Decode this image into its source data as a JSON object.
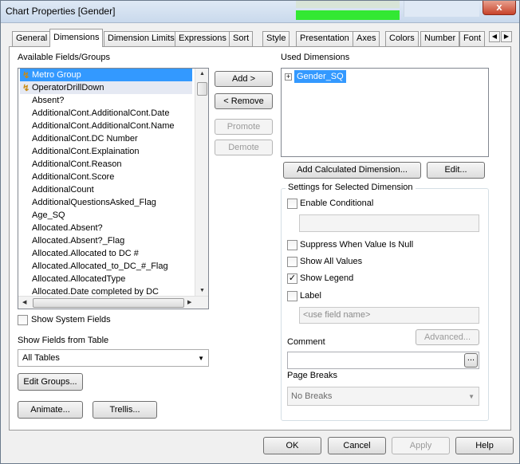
{
  "window": {
    "title": "Chart Properties [Gender]",
    "close_label": "x"
  },
  "tabs": [
    {
      "label": "General"
    },
    {
      "label": "Dimensions"
    },
    {
      "label": "Dimension Limits"
    },
    {
      "label": "Expressions"
    },
    {
      "label": "Sort"
    },
    {
      "label": "Style"
    },
    {
      "label": "Presentation"
    },
    {
      "label": "Axes"
    },
    {
      "label": "Colors"
    },
    {
      "label": "Number"
    },
    {
      "label": "Font"
    }
  ],
  "available": {
    "label": "Available Fields/Groups",
    "items": [
      "Metro Group",
      "OperatorDrillDown",
      "Absent?",
      "AdditionalCont.AdditionalCont.Date",
      "AdditionalCont.AdditionalCont.Name",
      "AdditionalCont.DC Number",
      "AdditionalCont.Explaination",
      "AdditionalCont.Reason",
      "AdditionalCont.Score",
      "AdditionalCount",
      "AdditionalQuestionsAsked_Flag",
      "Age_SQ",
      "Allocated.Absent?",
      "Allocated.Absent?_Flag",
      "Allocated.Allocated to DC #",
      "Allocated.Allocated_to_DC_#_Flag",
      "Allocated.AllocatedType",
      "Allocated.Date completed by DC"
    ],
    "show_system_fields": "Show System Fields",
    "show_fields_from_table": "Show Fields from Table",
    "table_selected": "All Tables",
    "edit_groups": "Edit Groups...",
    "animate": "Animate...",
    "trellis": "Trellis..."
  },
  "actions": {
    "add": "Add >",
    "remove": "< Remove",
    "promote": "Promote",
    "demote": "Demote"
  },
  "used": {
    "label": "Used Dimensions",
    "items": [
      "Gender_SQ"
    ],
    "add_calculated": "Add Calculated Dimension...",
    "edit": "Edit..."
  },
  "settings": {
    "legend": "Settings for Selected Dimension",
    "enable_conditional": "Enable Conditional",
    "suppress_null": "Suppress When Value Is Null",
    "show_all_values": "Show All Values",
    "show_legend": "Show Legend",
    "show_legend_checked": true,
    "label": "Label",
    "label_placeholder": "<use field name>",
    "advanced": "Advanced...",
    "comment": "Comment",
    "comment_btn": "...",
    "page_breaks": "Page Breaks",
    "page_breaks_selected": "No Breaks"
  },
  "footer": {
    "ok": "OK",
    "cancel": "Cancel",
    "apply": "Apply",
    "help": "Help"
  },
  "icons": {
    "drilldown": "drilldown-group-icon",
    "expand": "expand-plus-icon"
  }
}
